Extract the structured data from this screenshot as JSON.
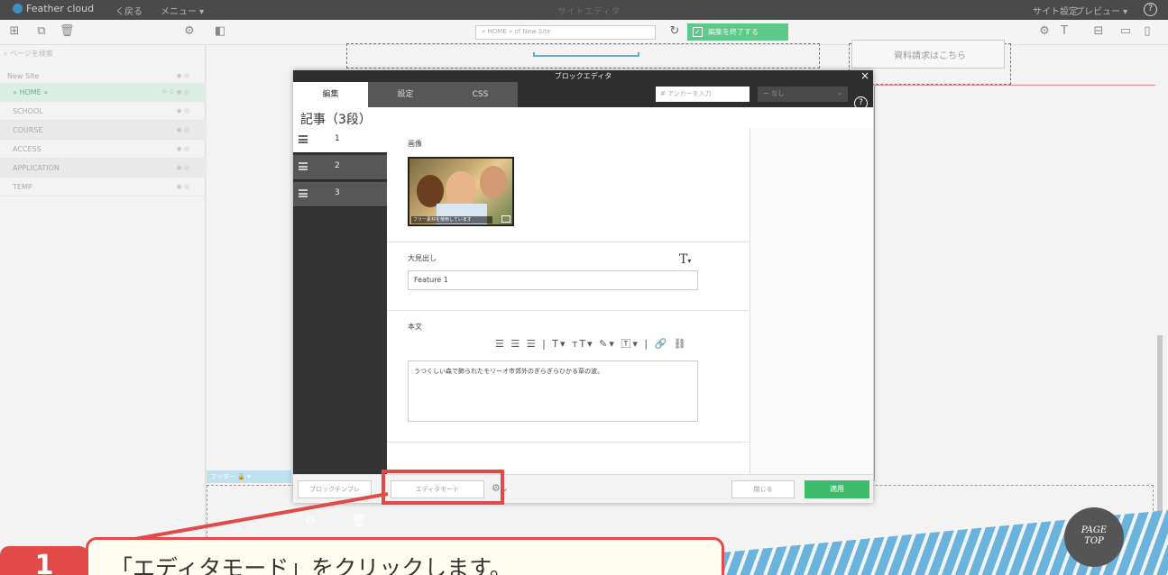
{
  "topbar": {
    "logo": "Feather cloud",
    "back": "く戻る",
    "menu": "メニュー ▾",
    "title": "サイトエディタ",
    "site_settings": "サイト設定",
    "preview": "プレビュー ▾",
    "help": "?"
  },
  "toolbar": {
    "address": "« HOME » of New Site",
    "end_edit": "編集を終了する"
  },
  "sidebar": {
    "search_placeholder": "ページを検索",
    "items": [
      {
        "label": "New Site"
      },
      {
        "label": "« HOME »"
      },
      {
        "label": "SCHOOL"
      },
      {
        "label": "COURSE"
      },
      {
        "label": "ACCESS"
      },
      {
        "label": "APPLICATION"
      },
      {
        "label": "TEMP"
      }
    ]
  },
  "canvas": {
    "doc_request": "資料請求はこちら",
    "footer_label": "フッター",
    "pagetop_line1": "PAGE",
    "pagetop_line2": "TOP"
  },
  "modal": {
    "title": "ブロックエディタ",
    "tabs": [
      "編集",
      "設定",
      "CSS"
    ],
    "anchor_placeholder": "# アンカーを入力",
    "dropdown": "ー なし",
    "block_title": "記事（3段）",
    "rows": [
      "1",
      "2",
      "3"
    ],
    "image_label": "画像",
    "image_caption": "フリー素材を使用しています",
    "heading_label": "大見出し",
    "heading_value": "Feature 1",
    "body_label": "本文",
    "body_text": "うつくしい森で飾られたモリーオ市郊外のぎらぎらひかる草の波。",
    "format_icons": "☰ ☰ ☰ | T▾ ᴛT▾ ✎▾ 🅃▾ | 🔗 ⛓",
    "footer": {
      "template_button": "ブロックテンプレ",
      "editor_mode_button": "エディタモード",
      "close_button": "閉じる",
      "apply_button": "適用"
    }
  },
  "annotation": {
    "step_number": "1",
    "instruction": "「エディタモード」をクリックします。",
    "accent_color": "#e24a4a"
  }
}
